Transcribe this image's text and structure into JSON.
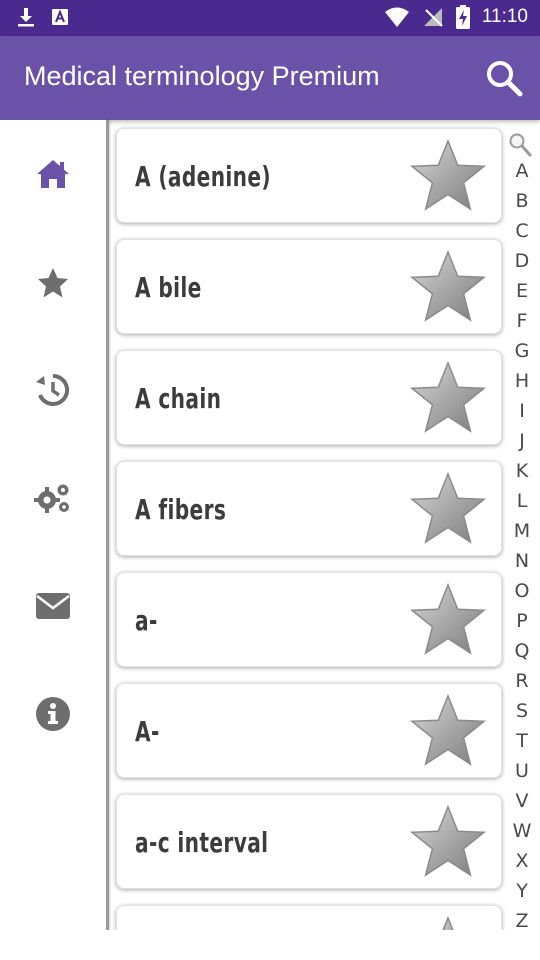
{
  "statusbar": {
    "time": "11:10"
  },
  "appbar": {
    "title": "Medical terminology Premium"
  },
  "sidebar": {
    "items": [
      {
        "icon": "home-icon",
        "color": "#6a52a8"
      },
      {
        "icon": "star-icon",
        "color": "#6e6e6e"
      },
      {
        "icon": "history-icon",
        "color": "#6e6e6e"
      },
      {
        "icon": "settings-icon",
        "color": "#6e6e6e"
      },
      {
        "icon": "mail-icon",
        "color": "#6e6e6e"
      },
      {
        "icon": "info-icon",
        "color": "#6e6e6e"
      }
    ]
  },
  "terms": [
    {
      "term": "A (adenine)"
    },
    {
      "term": "A bile"
    },
    {
      "term": "A chain"
    },
    {
      "term": "A fibers"
    },
    {
      "term": "a-"
    },
    {
      "term": "A-"
    },
    {
      "term": "a-c interval"
    },
    {
      "term": ""
    }
  ],
  "alphabet": [
    "A",
    "B",
    "C",
    "D",
    "E",
    "F",
    "G",
    "H",
    "I",
    "J",
    "K",
    "L",
    "M",
    "N",
    "O",
    "P",
    "Q",
    "R",
    "S",
    "T",
    "U",
    "V",
    "W",
    "X",
    "Y",
    "Z"
  ],
  "colors": {
    "statusbar": "#4b2a8f",
    "appbar": "#6a52a8",
    "accent": "#6a52a8"
  }
}
